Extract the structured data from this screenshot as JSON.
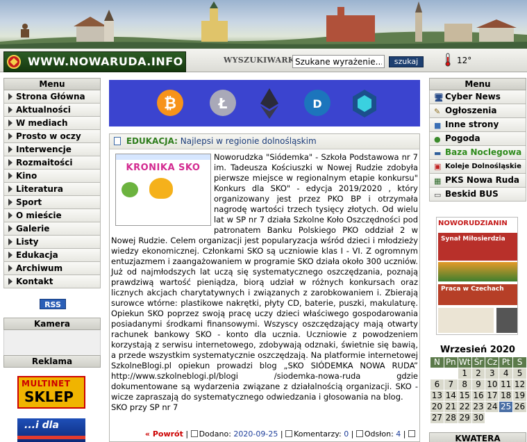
{
  "header": {
    "site_name": "WWW.NOWARUDA.INFO",
    "search_label": "WYSZUKIWARKA",
    "search_placeholder": "Szukane wyrażenie...",
    "search_button": "szukaj",
    "temperature": "12°"
  },
  "left_menu": {
    "title": "Menu",
    "items": [
      "Strona Główna",
      "Aktualności",
      "W mediach",
      "Prosto w oczy",
      "Interwencje",
      "Rozmaitości",
      "Kino",
      "Literatura",
      "Sport",
      "O mieście",
      "Galerie",
      "Listy",
      "Edukacja",
      "Archiwum",
      "Kontakt"
    ],
    "rss": "RSS",
    "camera_title": "Kamera",
    "ads_title": "Reklama",
    "ad1_line1": "MULTINET",
    "ad1_line2": "SKLEP",
    "ad2_text": "...i dla"
  },
  "article": {
    "category": "EDUKACJA:",
    "title": "Najlepsi w regionie dolnośląskim",
    "thumb_title": "KRONIKA SKO",
    "body": "Noworudzka \"Siódemka\" - Szkoła Podstawowa nr 7 im. Tadeusza Kościuszki w Nowej Rudzie zdobyła pierwsze miejsce w regionalnym etapie konkursu\" Konkurs dla SKO\" - edycja 2019/2020 , który organizowany jest przez PKO BP i otrzymała nagrodę wartości trzech tysięcy złotych. Od wielu lat w SP nr 7 działa Szkolne Koło Oszczędności pod patronatem Banku Polskiego PKO oddział 2 w Nowej Rudzie. Celem organizacji jest popularyzacja wśród dzieci i młodzieży wiedzy ekonomicznej. Członkami SKO są uczniowie klas I - VI. Z ogromnym entuzjazmem i zaangażowaniem w programie SKO działa około 300 uczniów. Już od najmłodszych lat uczą się systematycznego oszczędzania, poznają prawdziwą wartość pieniądza, biorą udział w różnych konkursach oraz licznych akcjach charytatywnych i związanych z zarobkowaniem i. Zbierają surowce wtórne: plastikowe nakrętki, płyty CD, baterie, puszki, makulaturę. Opiekun SKO poprzez swoją pracę uczy dzieci właściwego gospodarowania posiadanymi środkami finansowymi. Wszyscy oszczędzający mają otwarty rachunek bankowy SKO - konto dla ucznia. Uczniowie z powodzeniem korzystają z serwisu internetowego, zdobywają odznaki, świetnie się bawią, a przede wszystkim systematycznie oszczędzają. Na platformie internetowej SzkolneBlogi.pl opiekun prowadzi blog „SKO SIÓDEMKA NOWA RUDA” http://www.szkolneblogi.pl/blogi /siodemka-nowa-ruda gdzie dokumentowane są wydarzenia związane z działalnością organizacji. SKO - wicze zapraszają do systematycznego odwiedzania i głosowania na blog.",
    "signature": "SKO przy SP nr 7",
    "back": "« Powrót",
    "added_label": "Dodano:",
    "added_date": "2020-09-25",
    "comments_label": "Komentarzy:",
    "comments_count": "0",
    "views_label": "Odsłon:",
    "views_count": "4"
  },
  "right_menu": {
    "title": "Menu",
    "items": [
      {
        "label": "Cyber News",
        "icon": "monitor-icon",
        "color": "#000000"
      },
      {
        "label": "Ogłoszenia",
        "icon": "pencil-icon",
        "color": "#000000"
      },
      {
        "label": "Inne strony",
        "icon": "folder-icon",
        "color": "#000000"
      },
      {
        "label": "Pogoda",
        "icon": "sun-icon",
        "color": "#000000"
      },
      {
        "label": "Baza Noclegowa",
        "icon": "bed-icon",
        "color": "#2e8b1c"
      },
      {
        "label": "Koleje Dolnośląskie",
        "icon": "train-icon",
        "color": "#000000"
      },
      {
        "label": "PKS Nowa Ruda",
        "icon": "bus-sign-icon",
        "color": "#000000"
      },
      {
        "label": "Beskid BUS",
        "icon": "bus-icon",
        "color": "#000000"
      }
    ],
    "newspaper_title": "NOWORUDZIANIN",
    "newspaper_head1": "Synał Miłosierdzia",
    "newspaper_head2": "Praca w Czechach",
    "calendar_title": "Wrzesień 2020",
    "calendar_days": [
      "N",
      "Pn",
      "Wt",
      "Śr",
      "Cz",
      "Pt",
      "S"
    ],
    "calendar_weeks": [
      [
        "",
        "",
        "1",
        "2",
        "3",
        "4",
        "5"
      ],
      [
        "6",
        "7",
        "8",
        "9",
        "10",
        "11",
        "12"
      ],
      [
        "13",
        "14",
        "15",
        "16",
        "17",
        "18",
        "19"
      ],
      [
        "20",
        "21",
        "22",
        "23",
        "24",
        "25",
        "26"
      ],
      [
        "27",
        "28",
        "29",
        "30",
        "",
        "",
        ""
      ]
    ],
    "calendar_today": "25",
    "kwatera_title": "KWATERA"
  }
}
